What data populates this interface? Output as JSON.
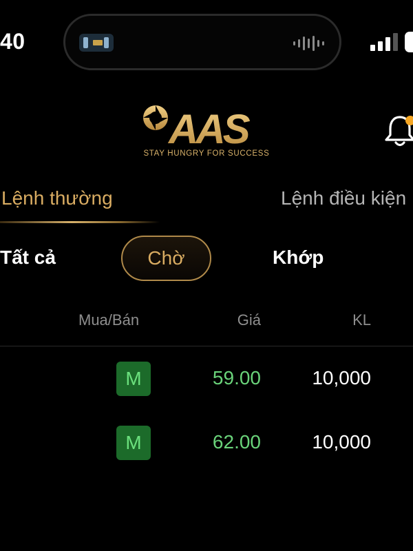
{
  "status_bar": {
    "time": "40"
  },
  "header": {
    "logo_text": "AAS",
    "tagline": "STAY HUNGRY FOR SUCCESS",
    "bell_icon": "bell-icon",
    "notification_color": "#f5a623"
  },
  "tabs": [
    {
      "label": "Lệnh thường",
      "active": true
    },
    {
      "label": "Lệnh điều kiện",
      "active": false
    }
  ],
  "filters": {
    "all": "Tất cả",
    "pending": "Chờ",
    "matched": "Khớp",
    "selected": "Chờ"
  },
  "table": {
    "columns": [
      "Mua/Bán",
      "Giá",
      "KL"
    ],
    "rows": [
      {
        "side": "M",
        "price": "59.00",
        "quantity": "10,000"
      },
      {
        "side": "M",
        "price": "62.00",
        "quantity": "10,000"
      }
    ]
  },
  "colors": {
    "accent_gold": "#d9ac62",
    "buy_green": "#6ad37a",
    "buy_badge_bg": "#1c6b2a"
  }
}
